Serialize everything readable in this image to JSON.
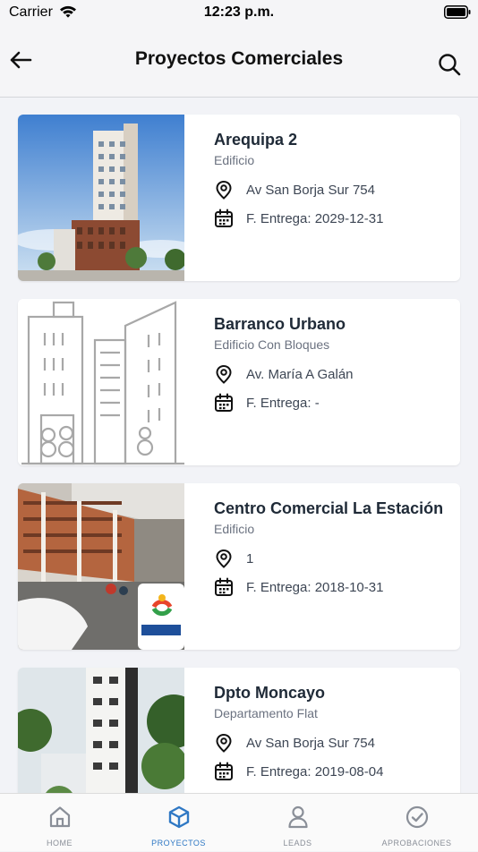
{
  "status_bar": {
    "carrier": "Carrier",
    "time": "12:23 p.m."
  },
  "nav": {
    "title": "Proyectos Comerciales",
    "back_icon": "arrow-left-icon",
    "search_icon": "search-icon"
  },
  "projects": [
    {
      "name": "Arequipa 2",
      "type": "Edificio",
      "address": "Av San Borja Sur 754",
      "delivery": "F. Entrega: 2029-12-31",
      "image": "building-render-photo"
    },
    {
      "name": "Barranco Urbano",
      "type": "Edificio Con Bloques",
      "address": "Av. María A Galán",
      "delivery": "F. Entrega: -",
      "image": "building-placeholder-illustration"
    },
    {
      "name": "Centro Comercial La Estación",
      "type": "Edificio",
      "address": "1",
      "delivery": "F. Entrega: 2018-10-31",
      "image": "mall-render-photo"
    },
    {
      "name": "Dpto Moncayo",
      "type": "Departamento Flat",
      "address": "Av San Borja Sur 754",
      "delivery": "F. Entrega: 2019-08-04",
      "image": "apartment-render-photo"
    }
  ],
  "tabs": [
    {
      "label": "HOME",
      "icon": "home-icon",
      "active": false
    },
    {
      "label": "PROYECTOS",
      "icon": "cube-icon",
      "active": true
    },
    {
      "label": "LEADS",
      "icon": "person-icon",
      "active": false
    },
    {
      "label": "APROBACIONES",
      "icon": "check-circle-icon",
      "active": false
    }
  ],
  "colors": {
    "accent": "#2f78c4",
    "inactive_tab": "#8a8f98",
    "background": "#f2f3f7"
  }
}
